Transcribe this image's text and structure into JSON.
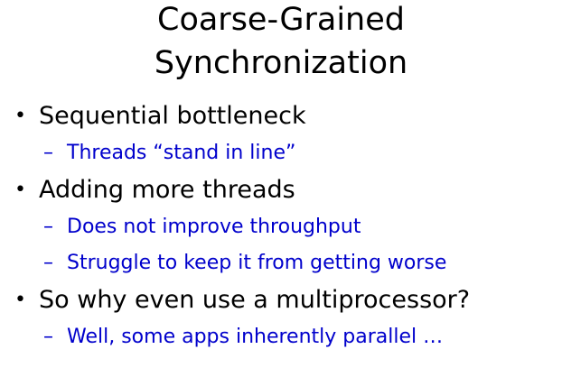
{
  "slide": {
    "title_lines": [
      "Coarse-Grained",
      "Synchronization"
    ],
    "bullet_marker": "•",
    "sub_marker": "–",
    "bullets": [
      {
        "text": "Sequential bottleneck",
        "subs": [
          "Threads “stand in line”"
        ]
      },
      {
        "text": "Adding more threads",
        "subs": [
          "Does not improve throughput",
          "Struggle to keep it from getting worse"
        ]
      },
      {
        "text": "So why even use a multiprocessor?",
        "subs": [
          "Well, some apps inherently parallel …"
        ]
      }
    ],
    "colors": {
      "background": "#ffffff",
      "title": "#000000",
      "bullet_text": "#000000",
      "sub_text": "#0000cc"
    }
  }
}
